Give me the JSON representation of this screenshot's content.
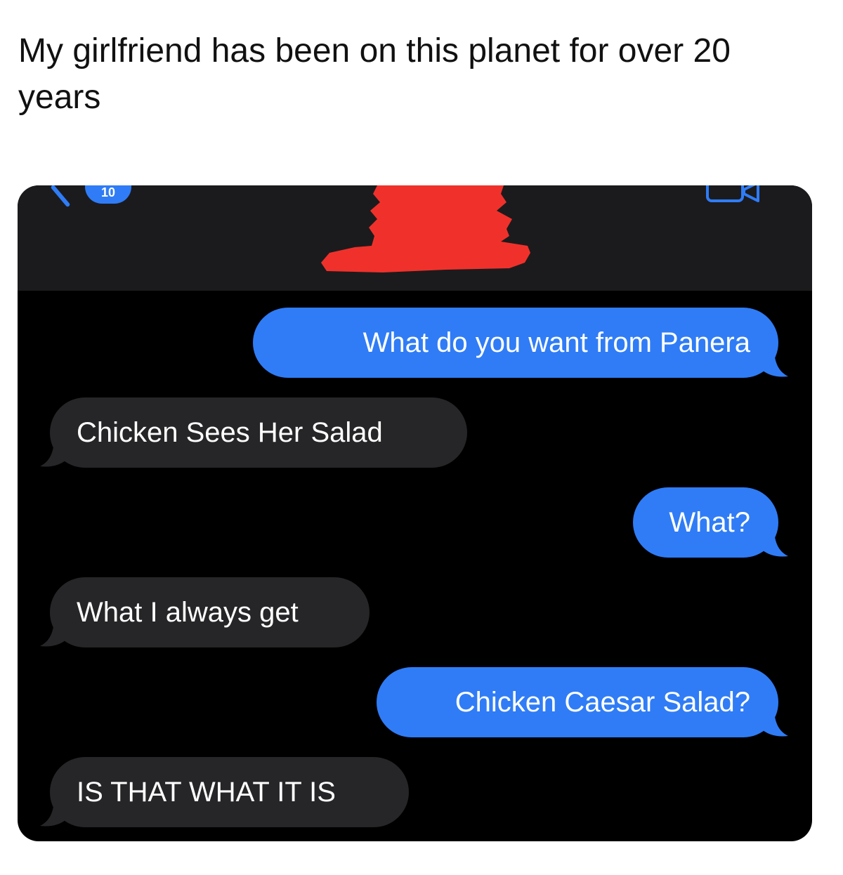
{
  "post": {
    "caption": "My girlfriend has been on this planet for over 20 years"
  },
  "header": {
    "back_count": "10",
    "contact_name_redacted": true
  },
  "conversation": {
    "messages": [
      {
        "direction": "sent",
        "text": "What do you want from Panera"
      },
      {
        "direction": "received",
        "text": "Chicken Sees Her Salad"
      },
      {
        "direction": "sent",
        "text": "What?"
      },
      {
        "direction": "received",
        "text": "What I always get"
      },
      {
        "direction": "sent",
        "text": "Chicken Caesar Salad?"
      },
      {
        "direction": "received",
        "text": "IS THAT WHAT IT IS"
      }
    ]
  },
  "colors": {
    "sent_bubble": "#2f7cf6",
    "received_bubble": "#262628",
    "screen_background": "#000000",
    "header_background": "#1b1b1d",
    "redaction": "#f0312b"
  },
  "icons": [
    "back-chevron-icon",
    "video-call-icon"
  ]
}
